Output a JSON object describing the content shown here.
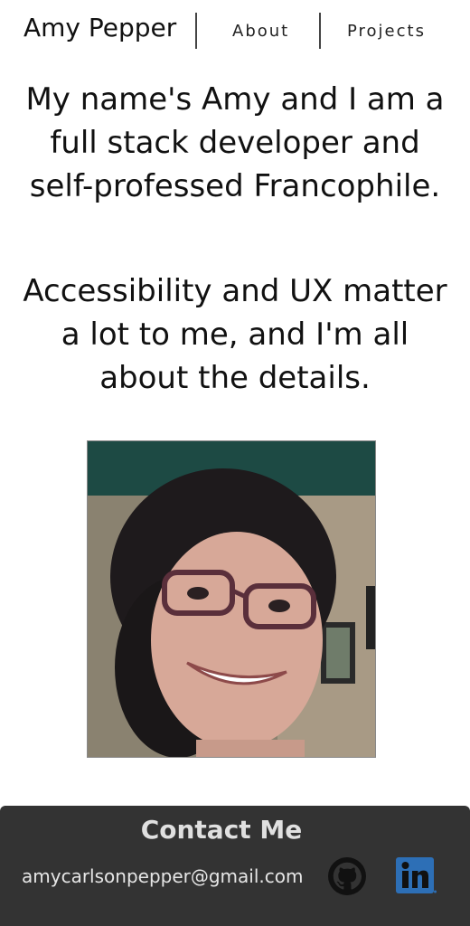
{
  "header": {
    "brand": "Amy Pepper",
    "nav": {
      "about": "About",
      "projects": "Projects"
    }
  },
  "intro": {
    "line_one": "My name's Amy and I am a full stack developer and self-professed Francophile.",
    "line_two": "Accessibility and UX matter a lot to me, and I'm all about the details."
  },
  "footer": {
    "title": "Contact Me",
    "email": "amycarlsonpepper@gmail.com",
    "icons": [
      "github-icon",
      "linkedin-icon"
    ]
  },
  "colors": {
    "footer_bg": "#333333",
    "linkedin_blue": "#2d6fb6"
  }
}
